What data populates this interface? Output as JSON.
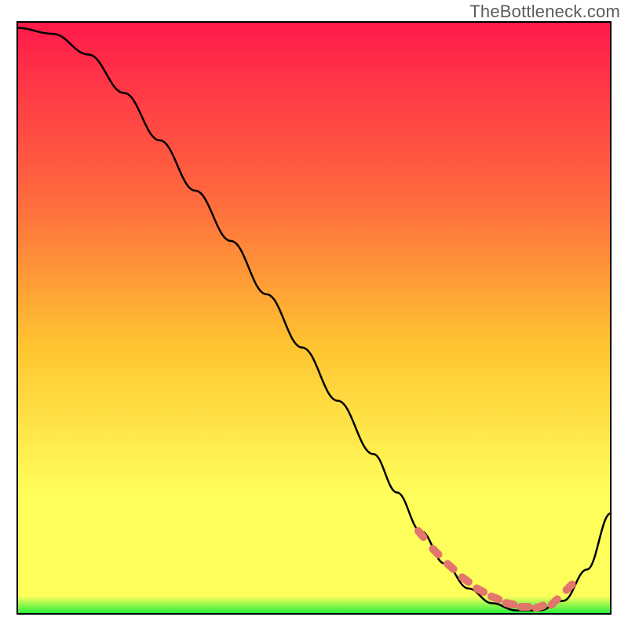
{
  "watermark": "TheBottleneck.com",
  "colors": {
    "gradient_top": "#ff1a4b",
    "gradient_upper_mid": "#ff6a3e",
    "gradient_mid": "#ffc531",
    "gradient_lower_mid": "#ffff5c",
    "gradient_bottom": "#1fef3c",
    "curve": "#000000",
    "marker": "#e2766d",
    "frame": "#000000"
  },
  "chart_data": {
    "type": "line",
    "title": "",
    "xlabel": "",
    "ylabel": "",
    "xlim": [
      0,
      100
    ],
    "ylim": [
      0,
      100
    ],
    "grid": false,
    "legend": false,
    "series": [
      {
        "name": "curve",
        "x": [
          0,
          6,
          12,
          18,
          24,
          30,
          36,
          42,
          48,
          54,
          60,
          64,
          68,
          72,
          76,
          80,
          84,
          88,
          92,
          96,
          100
        ],
        "y": [
          99,
          98,
          94.5,
          88,
          80,
          71.5,
          63,
          54,
          45,
          36,
          27,
          20.5,
          14,
          8.5,
          4.3,
          1.8,
          0.6,
          0.6,
          2.2,
          7.5,
          17
        ]
      }
    ],
    "markers": {
      "name": "highlight-points",
      "x": [
        68,
        70.5,
        73,
        75.5,
        78,
        80.5,
        83,
        85.5,
        88,
        90.5,
        93
      ],
      "y": [
        13.5,
        10.5,
        8.0,
        5.8,
        4.0,
        2.7,
        1.7,
        1.2,
        1.2,
        2.0,
        4.5
      ]
    }
  }
}
